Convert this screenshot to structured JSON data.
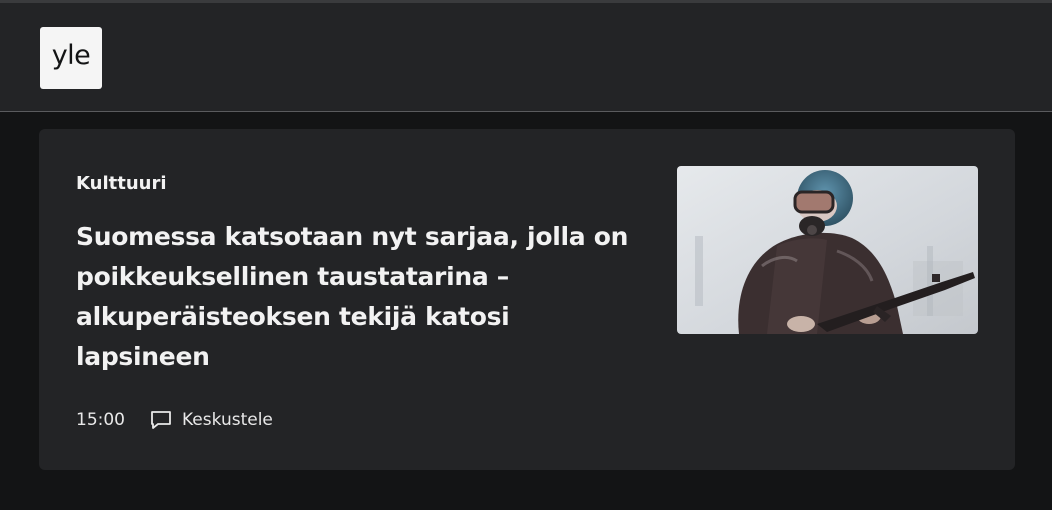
{
  "header": {
    "logo_text": "yle"
  },
  "article": {
    "category": "Kulttuuri",
    "headline": "Suomessa katsotaan nyt sarjaa, jolla on poikkeuksellinen taustatarina – alkuperäisteoksen tekijä katosi lapsineen",
    "time": "15:00",
    "comment_label": "Keskustele",
    "thumbnail_icon": "person-in-gas-mask-with-rifle-photo"
  },
  "colors": {
    "page_bg": "#131415",
    "card_bg": "#232426",
    "text": "#f2f2f2"
  }
}
